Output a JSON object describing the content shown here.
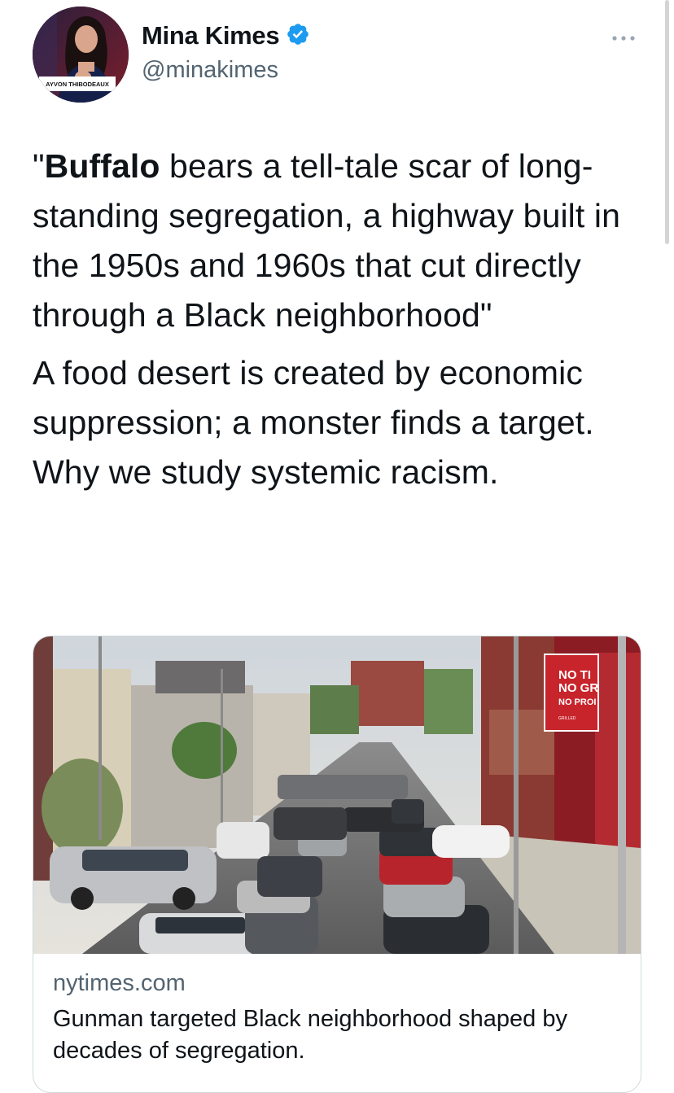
{
  "author": {
    "name": "Mina Kimes",
    "handle": "@minakimes",
    "avatar_caption": "AYVON THIBODEAUX"
  },
  "tweet": {
    "p1_bold": "Buffalo",
    "p1_open_quote": "\"",
    "p1_rest": " bears a tell-tale scar of long-standing segregation, a highway built in the 1950s and 1960s that cut directly through a Black neighborhood\"",
    "p2": "A food desert is created by economic suppression; a monster finds a target. Why we study systemic racism."
  },
  "card": {
    "source": "nytimes.com",
    "title": "Gunman targeted Black neighborhood shaped by decades of segregation.",
    "sign_lines": [
      "NO TI",
      "NO GR",
      "NO PROI",
      "GRILLED"
    ]
  },
  "icons": {
    "verified": "verified-badge-icon",
    "more": "more-options-icon"
  },
  "colors": {
    "text": "#0f1419",
    "secondary": "#536471",
    "verified": "#1d9bf0",
    "border": "#cfd9de"
  }
}
